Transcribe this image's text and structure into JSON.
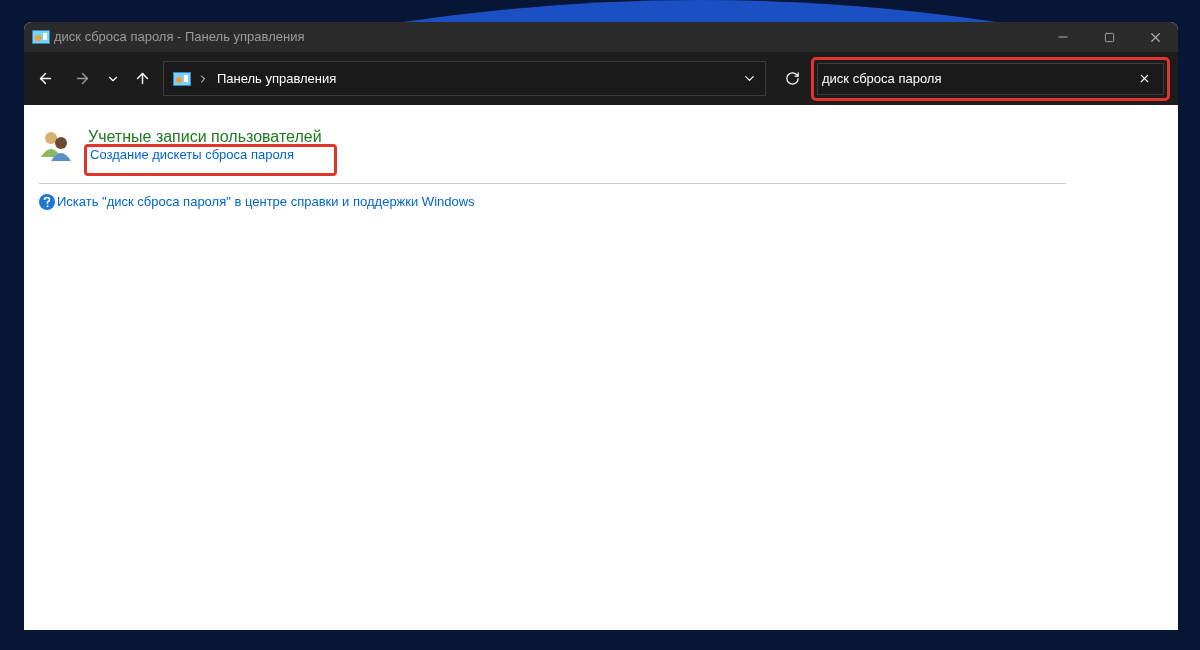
{
  "window": {
    "title": "диск сброса пароля - Панель управления"
  },
  "address_bar": {
    "breadcrumb": "Панель управления"
  },
  "search": {
    "value": "диск сброса пароля"
  },
  "results": [
    {
      "category": "Учетные записи пользователей",
      "links": [
        "Создание дискеты сброса пароля"
      ]
    }
  ],
  "help_link": "Искать \"диск сброса пароля\" в центре справки и поддержки Windows"
}
